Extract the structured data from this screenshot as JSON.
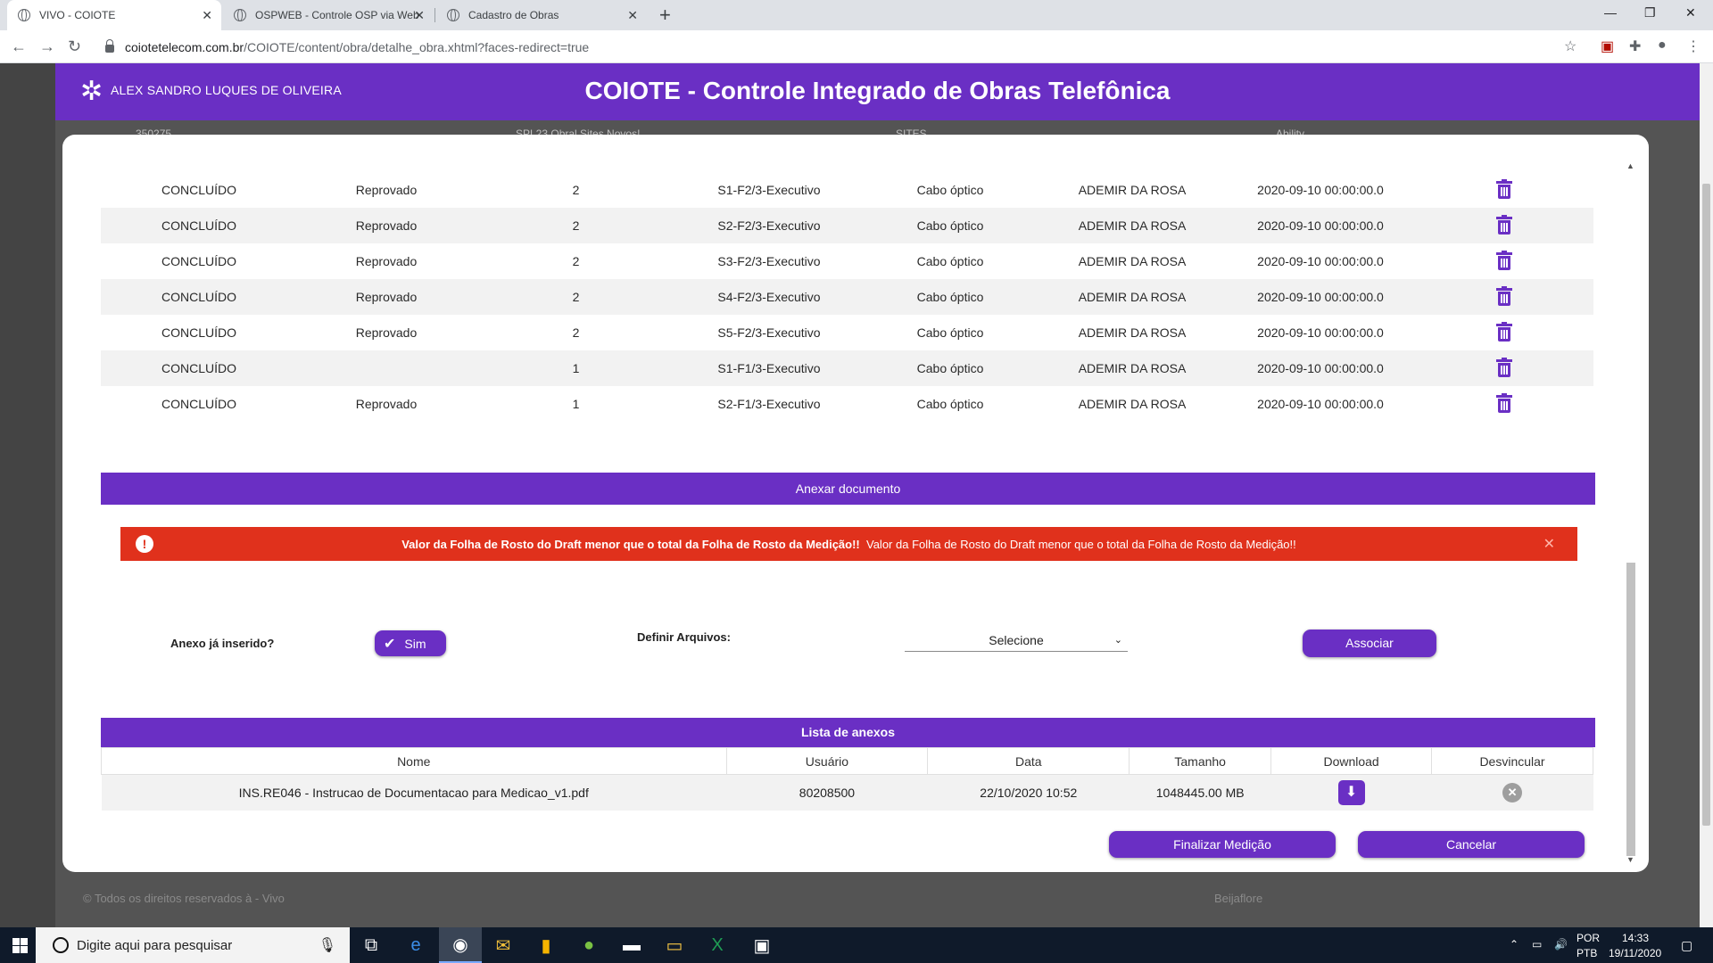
{
  "browser": {
    "tabs": [
      {
        "title": "VIVO - COIOTE",
        "active": true
      },
      {
        "title": "OSPWEB - Controle OSP via Web",
        "active": false
      },
      {
        "title": "Cadastro de Obras",
        "active": false
      }
    ],
    "new_tab": "+",
    "url_host": "coiotetelecom.com.br",
    "url_path": "/COIOTE/content/obra/detalhe_obra.xhtml?faces-redirect=true"
  },
  "app": {
    "user_name": "ALEX SANDRO LUQUES DE OLIVEIRA",
    "title": "COIOTE - Controle Integrado de Obras Telefônica",
    "brand_color": "#6a2fc4",
    "footer_copyright": "© Todos os direitos reservados à - Vivo",
    "footer_right": "Beijaflore",
    "background_row": [
      "350275",
      "SPL23 Obral Sites Novos!",
      "SITES",
      "Ability"
    ]
  },
  "table": {
    "rows": [
      {
        "status": "CONCLUÍDO",
        "result": "Reprovado",
        "version": "2",
        "phase": "S1-F2/3-Executivo",
        "type": "Cabo óptico",
        "user": "ADEMIR DA ROSA",
        "date": "2020-09-10 00:00:00.0"
      },
      {
        "status": "CONCLUÍDO",
        "result": "Reprovado",
        "version": "2",
        "phase": "S2-F2/3-Executivo",
        "type": "Cabo óptico",
        "user": "ADEMIR DA ROSA",
        "date": "2020-09-10 00:00:00.0"
      },
      {
        "status": "CONCLUÍDO",
        "result": "Reprovado",
        "version": "2",
        "phase": "S3-F2/3-Executivo",
        "type": "Cabo óptico",
        "user": "ADEMIR DA ROSA",
        "date": "2020-09-10 00:00:00.0"
      },
      {
        "status": "CONCLUÍDO",
        "result": "Reprovado",
        "version": "2",
        "phase": "S4-F2/3-Executivo",
        "type": "Cabo óptico",
        "user": "ADEMIR DA ROSA",
        "date": "2020-09-10 00:00:00.0"
      },
      {
        "status": "CONCLUÍDO",
        "result": "Reprovado",
        "version": "2",
        "phase": "S5-F2/3-Executivo",
        "type": "Cabo óptico",
        "user": "ADEMIR DA ROSA",
        "date": "2020-09-10 00:00:00.0"
      },
      {
        "status": "CONCLUÍDO",
        "result": "",
        "version": "1",
        "phase": "S1-F1/3-Executivo",
        "type": "Cabo óptico",
        "user": "ADEMIR DA ROSA",
        "date": "2020-09-10 00:00:00.0"
      },
      {
        "status": "CONCLUÍDO",
        "result": "Reprovado",
        "version": "1",
        "phase": "S2-F1/3-Executivo",
        "type": "Cabo óptico",
        "user": "ADEMIR DA ROSA",
        "date": "2020-09-10 00:00:00.0"
      }
    ],
    "row_action_icon": "trash-icon"
  },
  "attach_section": {
    "title": "Anexar documento",
    "alert_bold": "Valor da Folha de Rosto do Draft menor que o total da Folha de Rosto da Medição!!",
    "alert_text": "Valor da Folha de Rosto do Draft menor que o total da Folha de Rosto da Medição!!",
    "alert_color": "#e0311c",
    "already_label": "Anexo já inserido?",
    "toggle_label": "Sim",
    "define_label": "Definir Arquivos:",
    "select_value": "Selecione",
    "associate_button": "Associar"
  },
  "attachments": {
    "title": "Lista de anexos",
    "columns": [
      "Nome",
      "Usuário",
      "Data",
      "Tamanho",
      "Download",
      "Desvincular"
    ],
    "rows": [
      {
        "name": "INS.RE046 - Instrucao de Documentacao para Medicao_v1.pdf",
        "user": "80208500",
        "date": "22/10/2020 10:52",
        "size": "1048445.00 MB"
      }
    ]
  },
  "actions": {
    "finish": "Finalizar Medição",
    "cancel": "Cancelar"
  },
  "taskbar": {
    "search_placeholder": "Digite aqui para pesquisar",
    "lang_1": "POR",
    "lang_2": "PTB",
    "time": "14:33",
    "date": "19/11/2020"
  }
}
